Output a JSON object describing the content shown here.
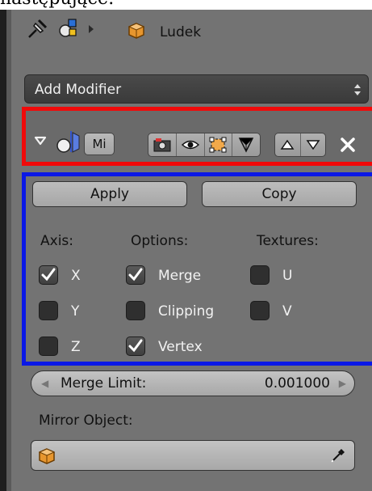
{
  "top_text": "następujące:",
  "header": {
    "object_name": "Ludek"
  },
  "add_modifier": {
    "label": "Add Modifier"
  },
  "modifier": {
    "name_value": "Mi"
  },
  "buttons": {
    "apply": "Apply",
    "copy": "Copy"
  },
  "columns": {
    "axis": {
      "title": "Axis:",
      "items": [
        {
          "label": "X",
          "checked": true
        },
        {
          "label": "Y",
          "checked": false
        },
        {
          "label": "Z",
          "checked": false
        }
      ]
    },
    "options": {
      "title": "Options:",
      "items": [
        {
          "label": "Merge",
          "checked": true
        },
        {
          "label": "Clipping",
          "checked": false
        },
        {
          "label": "Vertex",
          "checked": true
        }
      ]
    },
    "textures": {
      "title": "Textures:",
      "items": [
        {
          "label": "U",
          "checked": false
        },
        {
          "label": "V",
          "checked": false
        }
      ]
    }
  },
  "merge_limit": {
    "label": "Merge Limit:",
    "value": "0.001000"
  },
  "mirror_object": {
    "label": "Mirror Object:"
  },
  "colors": {
    "highlight_red": "#f00a0a",
    "highlight_blue": "#0a18e6",
    "panel_bg": "#737373"
  }
}
